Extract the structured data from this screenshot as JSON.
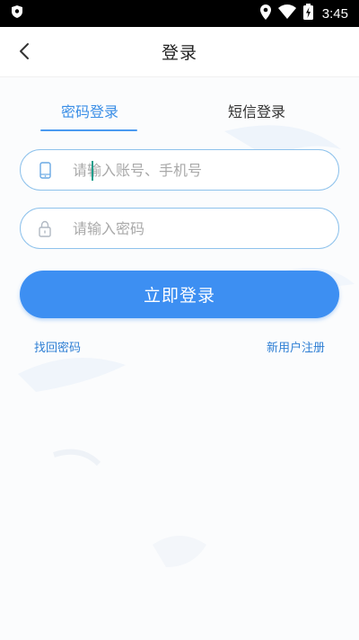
{
  "status_bar": {
    "time": "3:45"
  },
  "header": {
    "title": "登录"
  },
  "tabs": [
    {
      "label": "密码登录",
      "active": true
    },
    {
      "label": "短信登录",
      "active": false
    }
  ],
  "form": {
    "account": {
      "value": "",
      "placeholder": "请输入账号、手机号"
    },
    "password": {
      "value": "",
      "placeholder": "请输入密码"
    }
  },
  "login_button_label": "立即登录",
  "links": {
    "forgot": "找回密码",
    "register": "新用户注册"
  },
  "colors": {
    "accent": "#3d8ff2",
    "tab_active": "#3a8ee6",
    "input_border": "#8ec2ec",
    "link": "#2f7fd4"
  },
  "icons": [
    "shield-icon",
    "location-icon",
    "wifi-icon",
    "battery-charging-icon",
    "back-arrow-icon",
    "phone-icon",
    "lock-icon"
  ]
}
